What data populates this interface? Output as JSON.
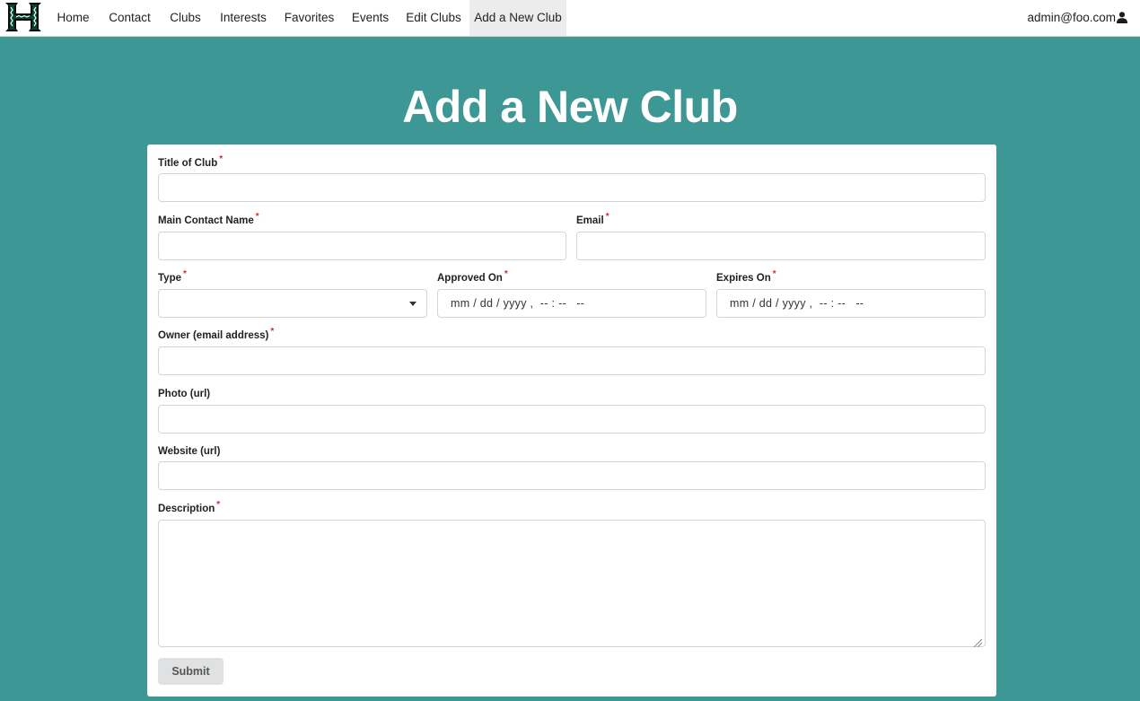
{
  "nav": {
    "items": [
      {
        "label": "Home"
      },
      {
        "label": "Contact"
      },
      {
        "label": "Clubs"
      },
      {
        "label": "Interests"
      },
      {
        "label": "Favorites"
      },
      {
        "label": "Events"
      },
      {
        "label": "Edit Clubs"
      },
      {
        "label": "Add a New Club"
      }
    ],
    "active": "Add a New Club",
    "user_email": "admin@foo.com",
    "logo_icon": "hawaii-h-logo-icon",
    "user_icon": "user-icon"
  },
  "page": {
    "title": "Add a New Club"
  },
  "form": {
    "required_marker": "*",
    "fields": {
      "title": {
        "label": "Title of Club",
        "required": true,
        "value": ""
      },
      "contact_name": {
        "label": "Main Contact Name",
        "required": true,
        "value": ""
      },
      "email": {
        "label": "Email",
        "required": true,
        "value": ""
      },
      "type": {
        "label": "Type",
        "required": true,
        "value": ""
      },
      "approved_on": {
        "label": "Approved On",
        "required": true,
        "placeholder": "mm / dd / yyyy ,  -- : --   --"
      },
      "expires_on": {
        "label": "Expires On",
        "required": true,
        "placeholder": "mm / dd / yyyy ,  -- : --   --"
      },
      "owner": {
        "label": "Owner (email address)",
        "required": true,
        "value": ""
      },
      "photo": {
        "label": "Photo (url)",
        "required": false,
        "value": ""
      },
      "website": {
        "label": "Website (url)",
        "required": false,
        "value": ""
      },
      "description": {
        "label": "Description",
        "required": true,
        "value": ""
      }
    },
    "submit_label": "Submit"
  },
  "colors": {
    "page_background": "#3d9795",
    "required_star": "#db2828",
    "button_background": "#e0e1e2",
    "logo_green": "#024731"
  }
}
